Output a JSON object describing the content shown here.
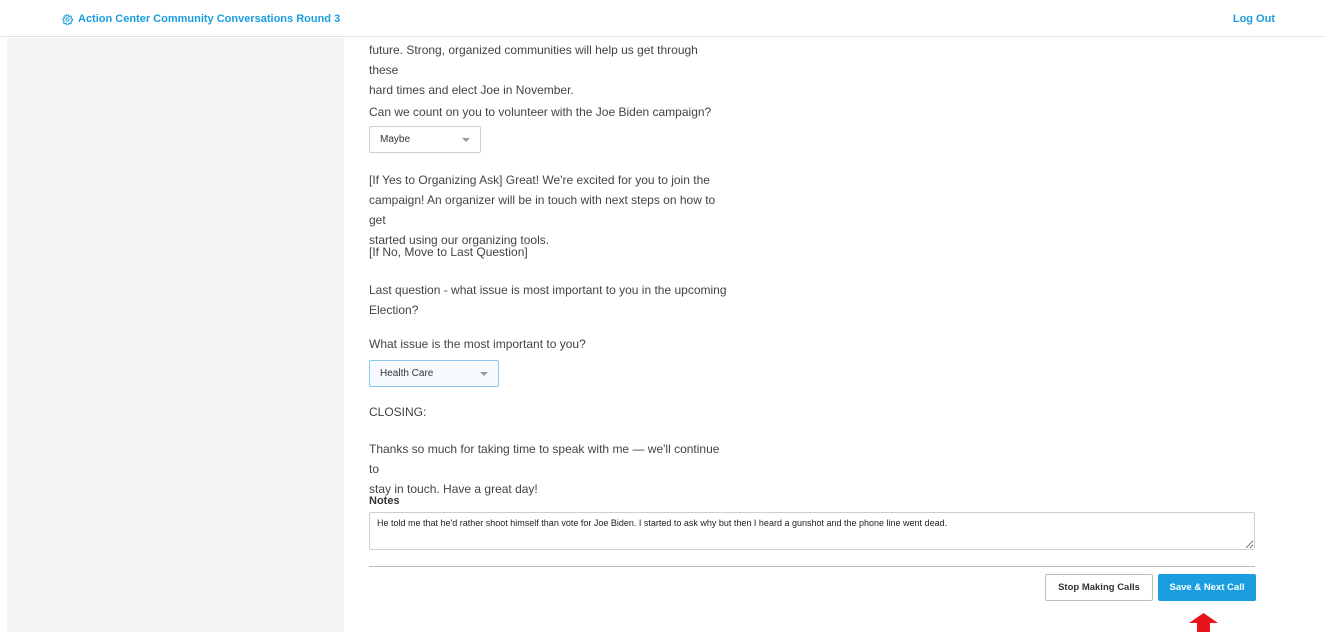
{
  "header": {
    "brand_label": "Action Center Community Conversations Round 3",
    "brand_icon": "gear-icon",
    "logout_label": "Log Out",
    "accent_color": "#1a9ee0"
  },
  "script": {
    "intro_line1": "future. Strong, organized communities will help us get through these",
    "intro_line2": "hard times and elect Joe in November.",
    "volunteer_question": "Can we count on you to volunteer with the Joe Biden campaign?",
    "volunteer_select_value": "Maybe",
    "if_yes_line1": "[If Yes to Organizing Ask] Great! We're excited for you to join the",
    "if_yes_line2": "campaign! An organizer will be in touch with next steps on how to get",
    "if_yes_line3": "started using our organizing tools.",
    "if_no": "[If No, Move to Last Question]",
    "last_question_line1": "Last question - what issue is most important to you in the upcoming",
    "last_question_line2": "Election?",
    "issue_question": "What issue is the most important to you?",
    "issue_select_value": "Health Care",
    "closing_heading": "CLOSING:",
    "closing_line1": "Thanks so much for taking time to speak with me — we'll continue to",
    "closing_line2": "stay in touch. Have a great day!"
  },
  "notes": {
    "label": "Notes",
    "value": "He told me that he'd rather shoot himself than vote for Joe Biden. I started to ask why but then I heard a gunshot and the phone line went dead."
  },
  "actions": {
    "stop_label": "Stop Making Calls",
    "save_label": "Save & Next Call",
    "annotation_arrow_color": "#e8141b"
  }
}
